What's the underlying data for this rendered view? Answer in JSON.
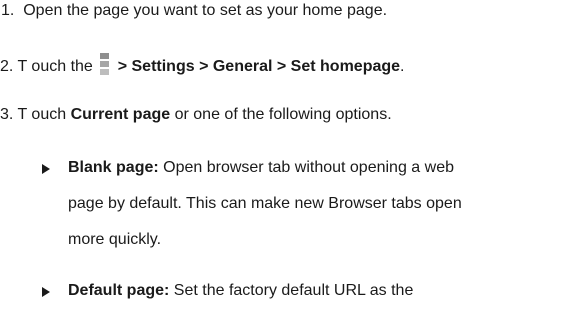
{
  "steps": {
    "step1": {
      "number": "1.",
      "text": "Open the page you want to set as your home page."
    },
    "step2": {
      "prefix": "2. T ouch the",
      "icon": "menu-icon",
      "path": "> Settings > General > Set homepage",
      "suffix": "."
    },
    "step3": {
      "prefix": "3. T ouch",
      "bold": "Current page",
      "suffix": "or one of the following options."
    }
  },
  "options": [
    {
      "term": "Blank page:",
      "line1": "Open browser tab without opening a web",
      "line2": "page by default. This can make new Browser tabs open",
      "line3": "more quickly."
    },
    {
      "term": "Default page:",
      "line1": "Set the factory default URL as the"
    }
  ]
}
